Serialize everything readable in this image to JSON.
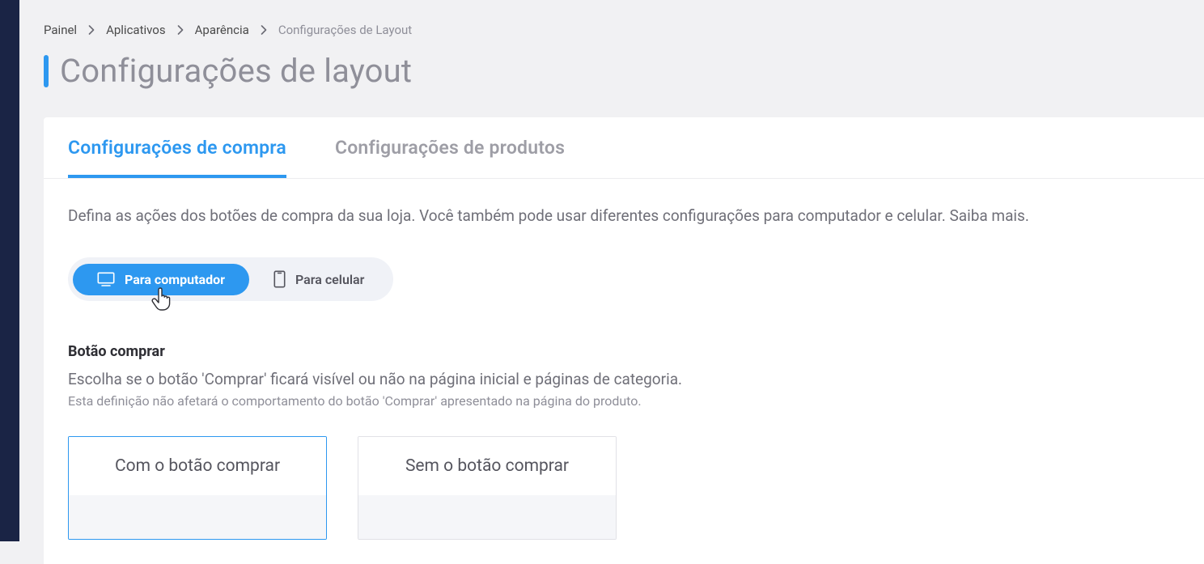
{
  "breadcrumb": {
    "items": [
      "Painel",
      "Aplicativos",
      "Aparência"
    ],
    "current": "Configurações de Layout"
  },
  "page": {
    "title": "Configurações de layout"
  },
  "tabs": [
    {
      "label": "Configurações de compra",
      "active": true
    },
    {
      "label": "Configurações de produtos",
      "active": false
    }
  ],
  "intro": {
    "text": "Defina as ações dos botões de compra da sua loja. Você também pode usar diferentes configurações para computador e celular. ",
    "learn_more": "Saiba mais."
  },
  "device_toggle": {
    "desktop": "Para computador",
    "mobile": "Para celular"
  },
  "buy_button_section": {
    "title": "Botão comprar",
    "description": "Escolha se o botão 'Comprar' ficará visível ou não na página inicial e páginas de categoria.",
    "note": "Esta definição não afetará o comportamento do botão 'Comprar' apresentado na página do produto.",
    "options": [
      {
        "label": "Com o botão comprar",
        "selected": true
      },
      {
        "label": "Sem o botão comprar",
        "selected": false
      }
    ]
  }
}
